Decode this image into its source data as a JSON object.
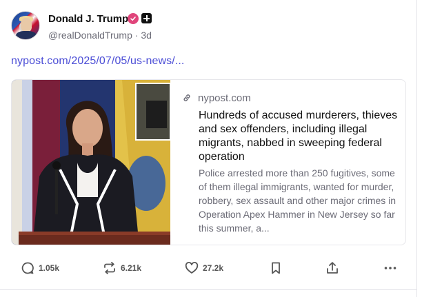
{
  "post": {
    "author_name": "Donald J. Trump",
    "handle": "@realDonaldTrump",
    "separator": "·",
    "time": "3d",
    "link_text": "nypost.com/2025/07/05/us-news/...",
    "card": {
      "domain": "nypost.com",
      "title": "Hundreds of accused murderers, thieves and sex offenders, including illegal migrants, nabbed in sweeping federal operation",
      "description": "Police arrested more than 250 fugitives, some of them illegal immigrants, wanted for murder, robbery, sex assault and other major crimes in Operation Apex Hammer in New Jersey so far this summer, a..."
    }
  },
  "actions": {
    "reply_count": "1.05k",
    "repost_count": "6.21k",
    "like_count": "27.2k"
  },
  "icons": {
    "reply": "comment-icon",
    "repost": "repost-icon",
    "like": "heart-icon",
    "bookmark": "bookmark-icon",
    "share": "share-icon",
    "more": "more-icon",
    "verified": "verified-badge-icon",
    "plus": "plus-badge-icon",
    "link": "link-icon"
  },
  "colors": {
    "link": "#4b4dd6",
    "verified_badge": "#e0457b",
    "muted_text": "#6b6b76"
  }
}
